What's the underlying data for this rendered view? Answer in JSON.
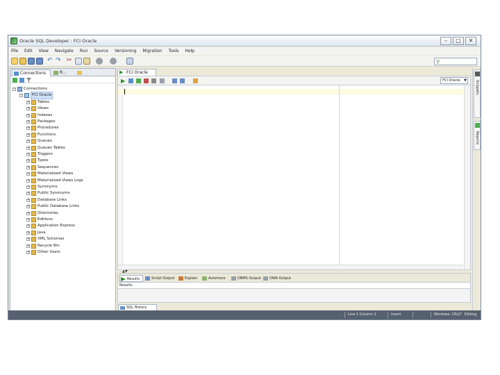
{
  "window": {
    "title": "Oracle SQL Developer : FCI Oracle",
    "min_label": "–",
    "max_label": "□",
    "close_label": "✕"
  },
  "menu": [
    "File",
    "Edit",
    "View",
    "Navigate",
    "Run",
    "Source",
    "Versioning",
    "Migration",
    "Tools",
    "Help"
  ],
  "left_panel": {
    "tabs": [
      "Connections",
      "R..."
    ],
    "tree": [
      {
        "label": "Connections",
        "expander": "−",
        "selected": false
      },
      {
        "label": "FCI Oracle",
        "expander": "−",
        "selected": true
      },
      {
        "label": "Tables",
        "expander": "+"
      },
      {
        "label": "Views",
        "expander": "+"
      },
      {
        "label": "Indexes",
        "expander": "+"
      },
      {
        "label": "Packages",
        "expander": "+"
      },
      {
        "label": "Procedures",
        "expander": "+"
      },
      {
        "label": "Functions",
        "expander": "+"
      },
      {
        "label": "Queues",
        "expander": "+"
      },
      {
        "label": "Queues Tables",
        "expander": "+"
      },
      {
        "label": "Triggers",
        "expander": "+"
      },
      {
        "label": "Types",
        "expander": "+"
      },
      {
        "label": "Sequences",
        "expander": "+"
      },
      {
        "label": "Materialized Views",
        "expander": "+"
      },
      {
        "label": "Materialized Views Logs",
        "expander": "+"
      },
      {
        "label": "Synonyms",
        "expander": "+"
      },
      {
        "label": "Public Synonyms",
        "expander": "+"
      },
      {
        "label": "Database Links",
        "expander": "+"
      },
      {
        "label": "Public Database Links",
        "expander": "+"
      },
      {
        "label": "Directories",
        "expander": "+"
      },
      {
        "label": "Editions",
        "expander": "+"
      },
      {
        "label": "Application Express",
        "expander": "+"
      },
      {
        "label": "Java",
        "expander": "+"
      },
      {
        "label": "XML Schemas",
        "expander": "+"
      },
      {
        "label": "Recycle Bin",
        "expander": "+"
      },
      {
        "label": "Other Users",
        "expander": "+"
      }
    ]
  },
  "editor": {
    "tab_label": "FCI Oracle",
    "connection": "FCI Oracle",
    "result_tabs": [
      "Results",
      "Script Output",
      "Explain",
      "Autotrace",
      "DBMS Output",
      "OWA Output"
    ],
    "results_label": "Results:",
    "bottom_tab": "SQL History"
  },
  "sidebar": {
    "tabs": [
      "Snippets",
      "Reports"
    ]
  },
  "status": {
    "mode": "Line 1 Column 1",
    "insert": "Insert",
    "ending": "Windows: CR/LF",
    "edit": "Editing"
  }
}
